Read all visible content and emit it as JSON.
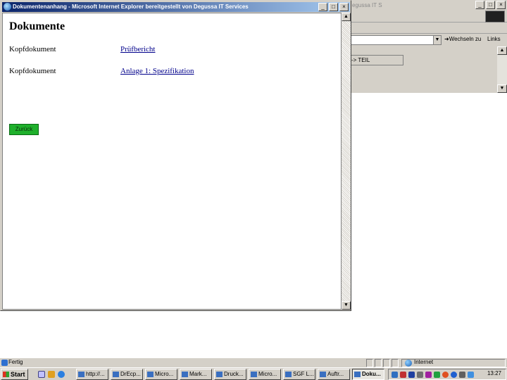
{
  "background_window": {
    "title": "egussa IT S",
    "title_buttons": [
      "_",
      "□",
      "×"
    ],
    "address_go": "Wechseln zu",
    "links": "Links",
    "field_value": "-> TEIL"
  },
  "popup": {
    "title": "Dokumentenanhang - Microsoft Internet Explorer bereitgestellt von Degussa IT Services",
    "title_buttons": [
      "_",
      "□",
      "×"
    ],
    "heading": "Dokumente",
    "rows": [
      {
        "label": "Kopfdokument",
        "link": "Prüfbericht"
      },
      {
        "label": "Kopfdokument",
        "link": "Anlage 1: Spezifikation"
      }
    ],
    "back_button": "Zurück"
  },
  "statusbar": {
    "text": "Fertig",
    "zone": "Internet"
  },
  "taskbar": {
    "start": "Start",
    "tasks": [
      "http://...",
      "DrEcp...",
      "Micro...",
      "Mark...",
      "Druck...",
      "Micro...",
      "SGF L...",
      "Auftr...",
      "Doku..."
    ],
    "clock": "13:27"
  },
  "colors": {
    "title_bar_start": "#0a246a",
    "title_bar_end": "#a6caf0",
    "button_green": "#1fb02c",
    "link": "#00008b",
    "window_face": "#d4d0c8"
  }
}
